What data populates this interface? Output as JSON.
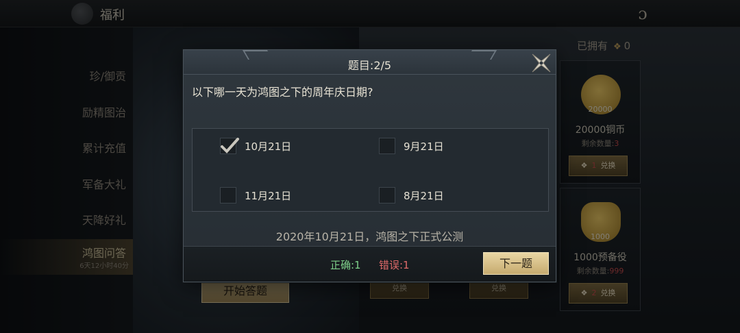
{
  "header": {
    "title": "福利"
  },
  "sidebar": {
    "tabs": [
      {
        "label": "珍/御贡"
      },
      {
        "label": "励精图治"
      },
      {
        "label": "累计充值"
      },
      {
        "label": "军备大礼"
      },
      {
        "label": "天降好礼"
      },
      {
        "label": "鸿图问答",
        "sub": "6天12小时40分",
        "active": true
      }
    ]
  },
  "main": {
    "owned_label": "已拥有",
    "owned_count": "0",
    "start_button": "开始答题",
    "cards": [
      {
        "qty": "20000",
        "name": "20000铜币",
        "remain_label": "剩余数量:",
        "remain": "3",
        "cost": "1",
        "btn": "兑换"
      },
      {
        "qty": "1000",
        "name": "1000预备役",
        "remain_label": "剩余数量:",
        "remain": "999",
        "cost": "2",
        "btn": "兑换"
      }
    ],
    "ghost_btn": "兑换"
  },
  "dialog": {
    "title": "题目:2/5",
    "question": "以下哪一天为鸿图之下的周年庆日期?",
    "options": [
      {
        "label": "10月21日",
        "checked": true
      },
      {
        "label": "9月21日",
        "checked": false
      },
      {
        "label": "11月21日",
        "checked": false
      },
      {
        "label": "8月21日",
        "checked": false
      }
    ],
    "explanation": "2020年10月21日，鸿图之下正式公测",
    "correct": "正确:1",
    "wrong": "错误:1",
    "next_button": "下一题"
  },
  "colors": {
    "accent_gold": "#d8c08a",
    "correct_green": "#7ed08a",
    "wrong_red": "#e06a6a"
  }
}
